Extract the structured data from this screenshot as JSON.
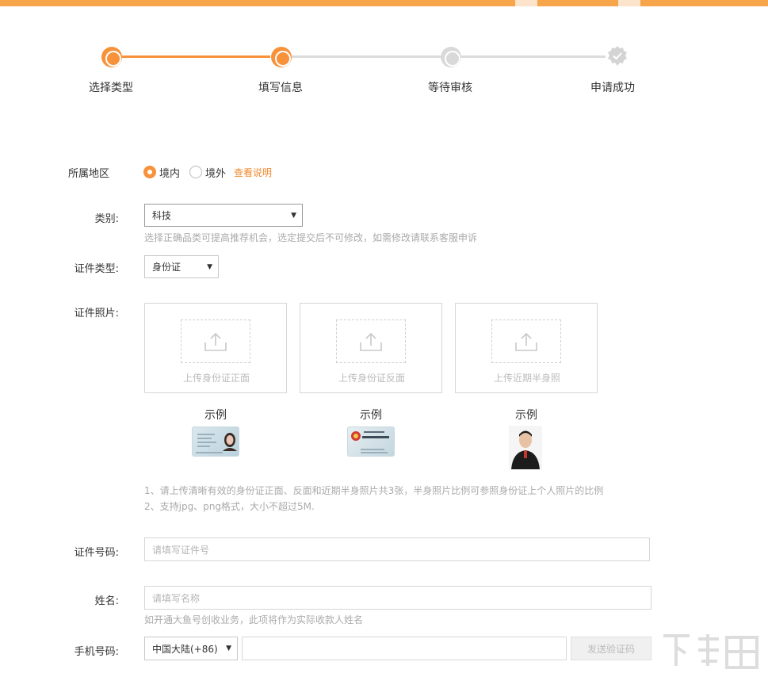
{
  "steps": [
    {
      "label": "选择类型",
      "state": "done"
    },
    {
      "label": "填写信息",
      "state": "active"
    },
    {
      "label": "等待审核",
      "state": "pending"
    },
    {
      "label": "申请成功",
      "state": "pending"
    }
  ],
  "colors": {
    "accent": "#f7913a",
    "top_bar": "#f7a54a",
    "link": "#f08a2c",
    "hint": "#aaaaaa"
  },
  "region": {
    "label": "所属地区",
    "options": [
      {
        "label": "境内",
        "checked": true
      },
      {
        "label": "境外",
        "checked": false
      }
    ],
    "help_link": "查看说明"
  },
  "category": {
    "label": "类别:",
    "value": "科技",
    "hint": "选择正确品类可提高推荐机会，选定提交后不可修改，如需修改请联系客服申诉"
  },
  "id_type": {
    "label": "证件类型:",
    "value": "身份证"
  },
  "id_photos": {
    "label": "证件照片:",
    "uploads": [
      {
        "label": "上传身份证正面",
        "example": "示例"
      },
      {
        "label": "上传身份证反面",
        "example": "示例"
      },
      {
        "label": "上传近期半身照",
        "example": "示例"
      }
    ],
    "notes": [
      "1、请上传清晰有效的身份证正面、反面和近期半身照片共3张，半身照片比例可参照身份证上个人照片的比例",
      "2、支持jpg、png格式，大小不超过5M."
    ]
  },
  "id_number": {
    "label": "证件号码:",
    "placeholder": "请填写证件号"
  },
  "name": {
    "label": "姓名:",
    "placeholder": "请填写名称",
    "hint": "如开通大鱼号创收业务，此项将作为实际收款人姓名"
  },
  "phone": {
    "label": "手机号码:",
    "country": "中国大陆(+86)",
    "value": "",
    "send_code": "发送验证码"
  }
}
